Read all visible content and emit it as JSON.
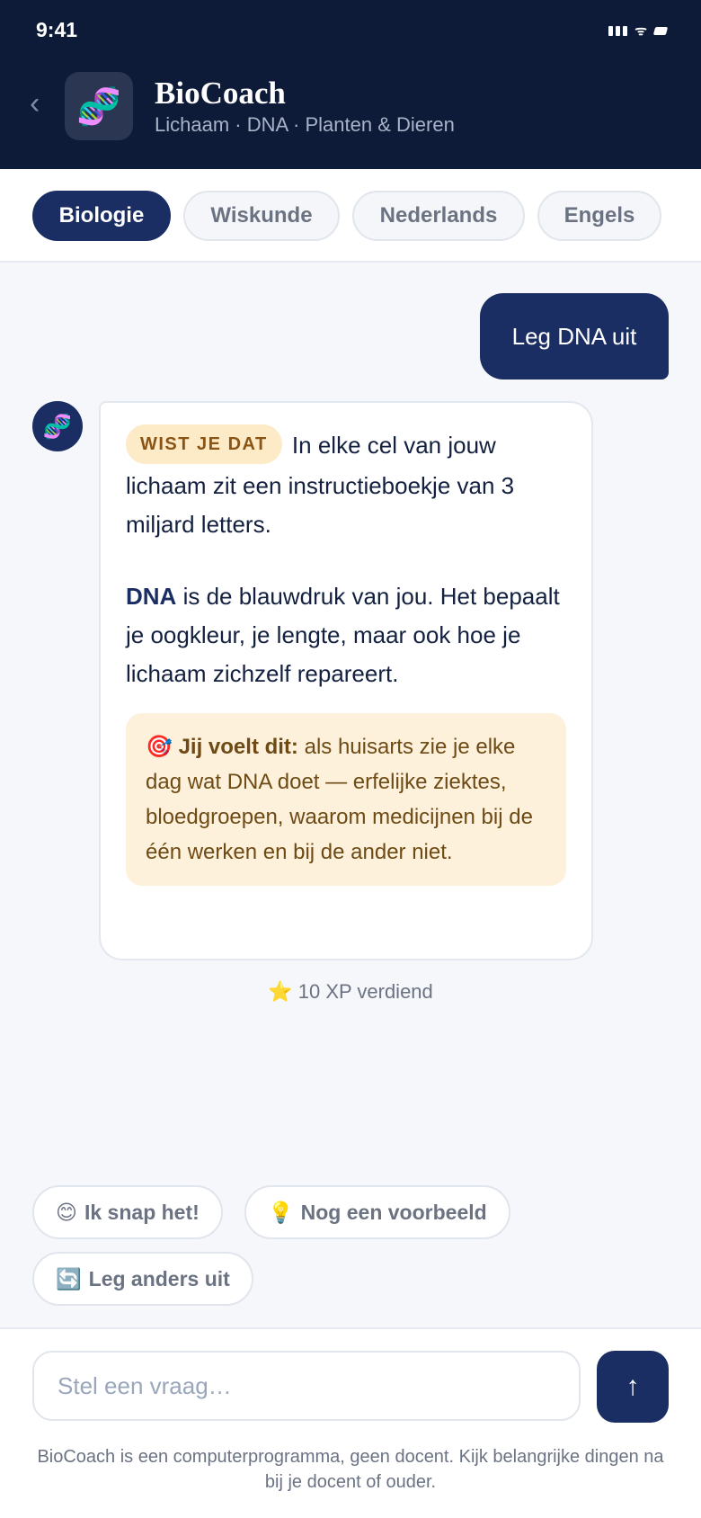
{
  "status_bar": {
    "time": "9:41"
  },
  "header": {
    "app_icon": "🧬",
    "title": "BioCoach",
    "subtitle": "Lichaam · DNA · Planten & Dieren"
  },
  "tabs": [
    {
      "label": "Biologie",
      "active": true
    },
    {
      "label": "Wiskunde",
      "active": false
    },
    {
      "label": "Nederlands",
      "active": false
    },
    {
      "label": "Engels",
      "active": false
    }
  ],
  "chat": {
    "user_message": "Leg DNA uit",
    "bot_avatar": "🧬",
    "bot_message": {
      "badge": "WIST JE DAT",
      "intro": "In elke cel van jouw lichaam zit een instructieboekje van 3 miljard letters.",
      "dna_term": "DNA",
      "body": "is de blauwdruk van jou. Het bepaalt je oogkleur, je lengte, maar ook hoe je lichaam zichzelf repareert.",
      "callout_icon": "🎯",
      "callout_title": "Jij voelt dit:",
      "callout_text": "als huisarts zie je elke dag wat DNA doet — erfelijke ziektes, bloedgroepen, waarom medicijnen bij de één werken en bij de ander niet."
    },
    "xp_icon": "⭐",
    "xp_text": "10 XP verdiend"
  },
  "quick_replies": [
    {
      "icon": "😊",
      "label": "Ik snap het!"
    },
    {
      "icon": "💡",
      "label": "Nog een voorbeeld"
    },
    {
      "icon": "🔄",
      "label": "Leg anders uit"
    }
  ],
  "composer": {
    "placeholder": "Stel een vraag…",
    "send_icon": "↑",
    "disclaimer": "BioCoach is een computerprogramma, geen docent. Kijk belangrijke dingen na bij je docent of ouder."
  },
  "colors": {
    "navy": "#0d1a38",
    "accent": "#1b2e63",
    "badge_bg": "#fdebc8",
    "callout_bg": "#fdf1dc"
  }
}
